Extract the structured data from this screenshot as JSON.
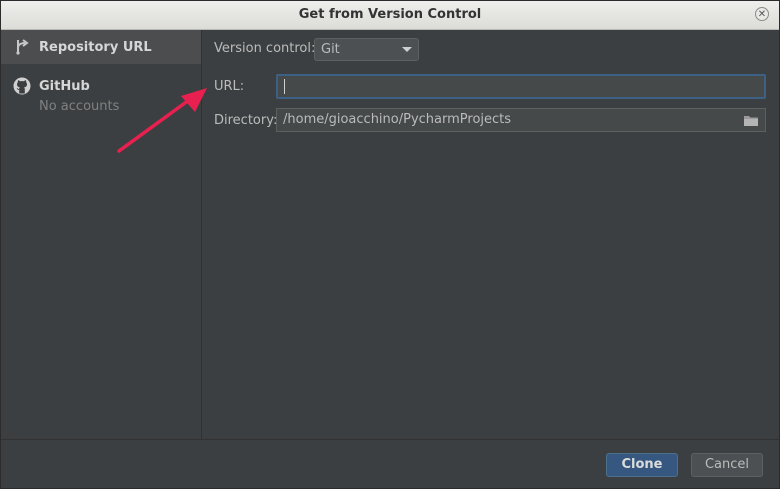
{
  "window": {
    "title": "Get from Version Control"
  },
  "sidebar": {
    "items": [
      {
        "label": "Repository URL",
        "icon": "vcs-fetch-icon",
        "selected": true
      },
      {
        "label": "GitHub",
        "sublabel": "No accounts",
        "icon": "github-icon",
        "selected": false
      }
    ]
  },
  "form": {
    "version_control_label": "Version control:",
    "version_control_value": "Git",
    "url_label": "URL:",
    "url_value": "",
    "directory_label": "Directory:",
    "directory_value": "/home/gioacchino/PycharmProjects"
  },
  "buttons": {
    "clone": "Clone",
    "cancel": "Cancel"
  },
  "colors": {
    "background": "#3c3f41",
    "focus_border": "#3d6185",
    "primary_button": "#365880",
    "annotation_arrow": "#e8204f"
  }
}
